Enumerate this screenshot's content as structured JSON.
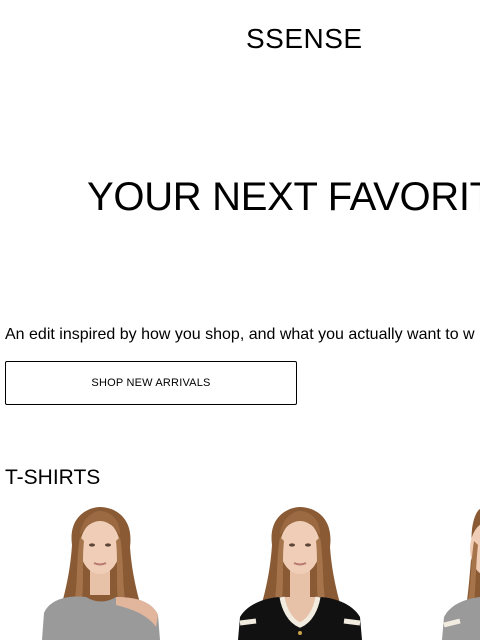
{
  "header": {
    "logo": "SSENSE"
  },
  "hero": {
    "title": "YOUR NEXT FAVORIT",
    "subtitle": "An edit inspired by how you shop, and what you actually want to w",
    "cta_label": "SHOP NEW ARRIVALS"
  },
  "section": {
    "title": "T-SHIRTS"
  },
  "products": [
    {
      "color": "#9a9a9a",
      "icon": "grey-off-shoulder-tshirt-image"
    },
    {
      "color": "#111111",
      "icon": "black-contrast-trim-tshirt-image"
    },
    {
      "color": "#9a9a9a",
      "icon": "grey-tshirt-image"
    }
  ]
}
